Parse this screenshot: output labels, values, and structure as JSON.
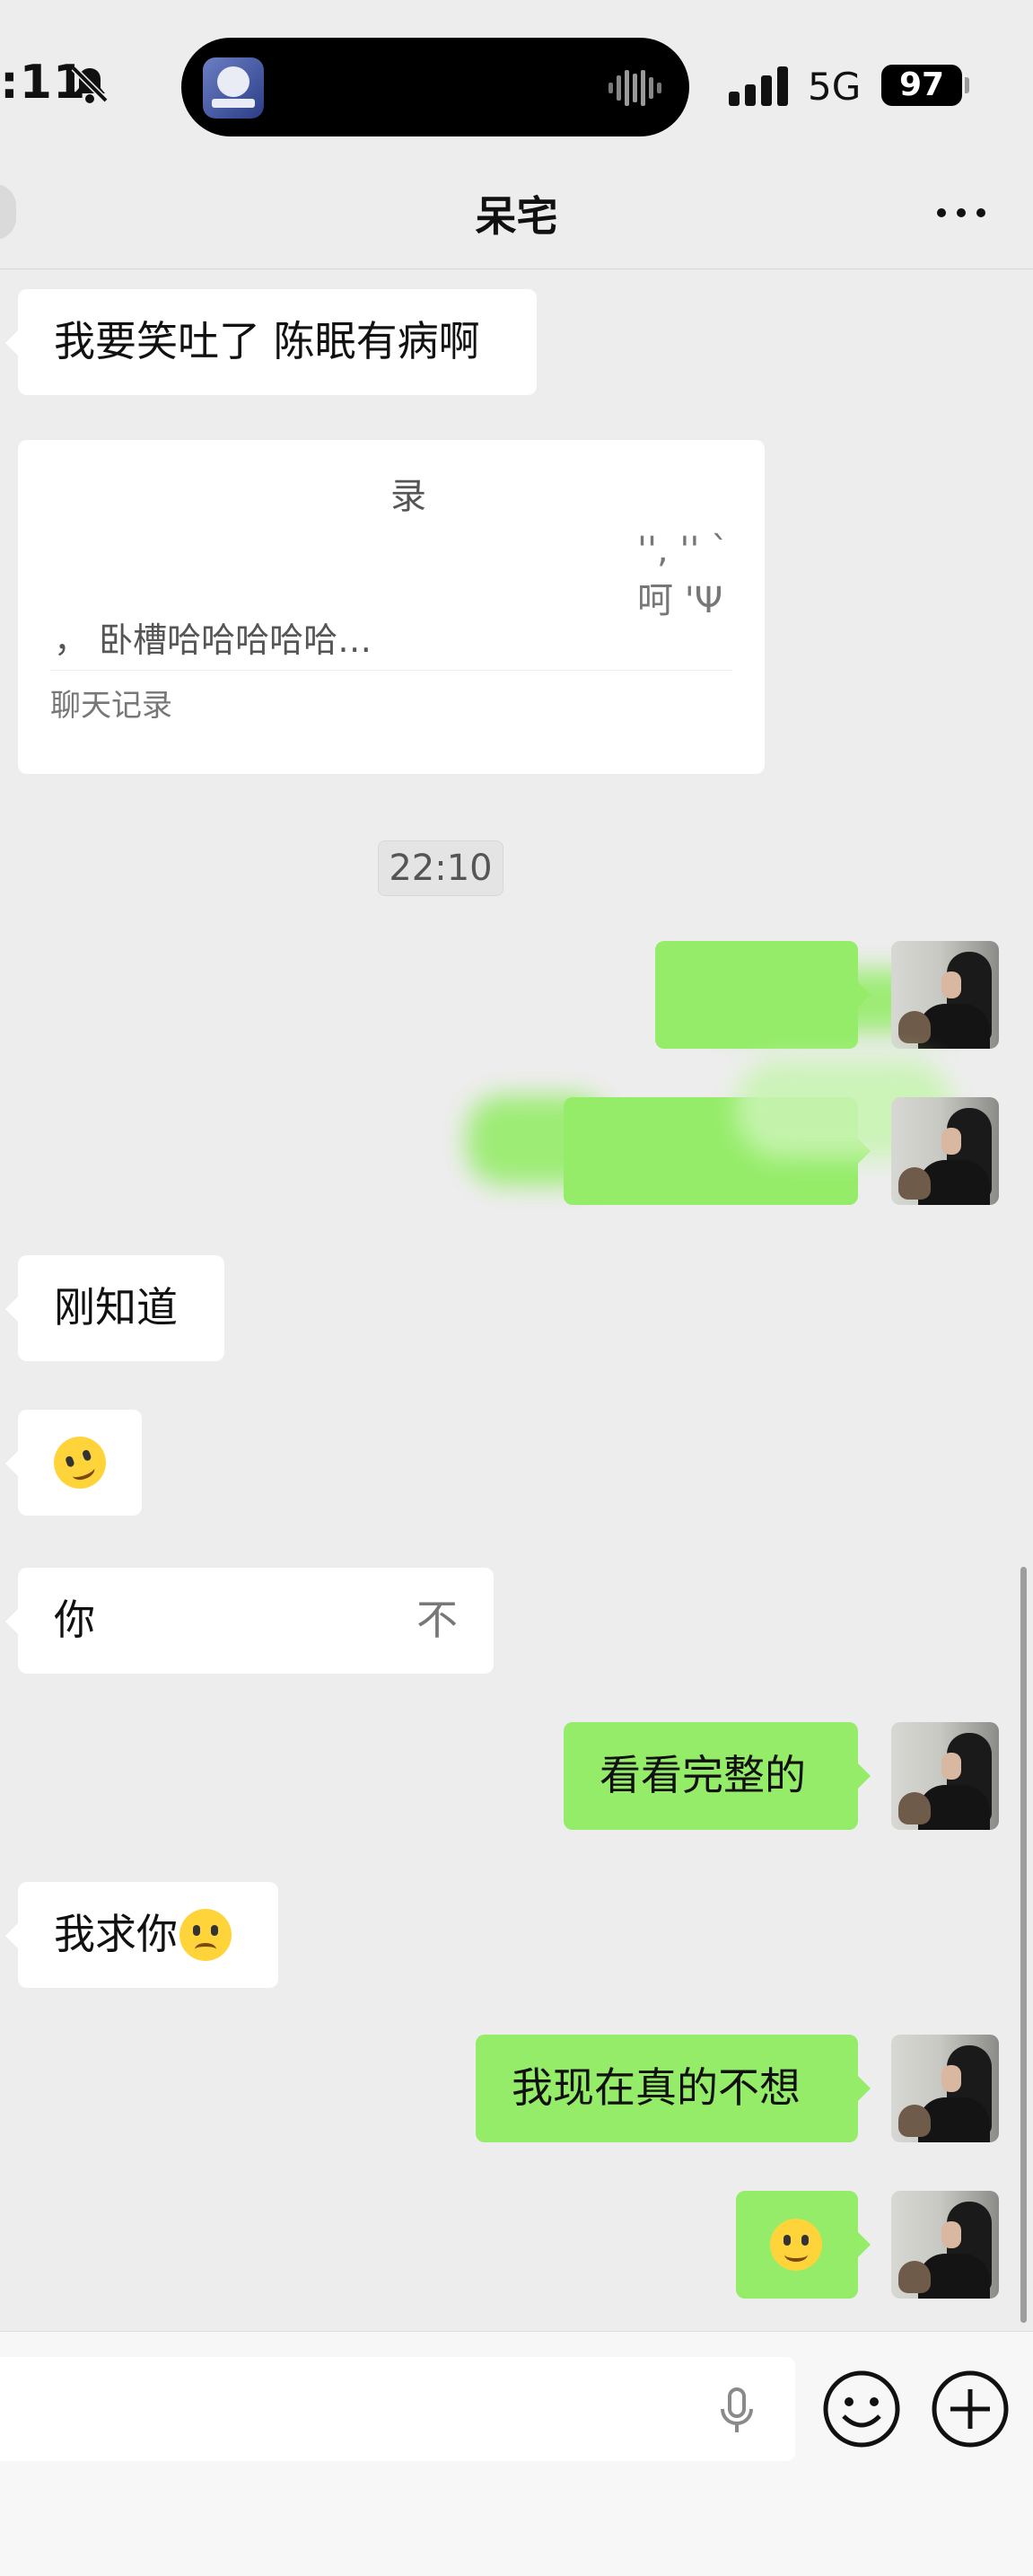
{
  "status_bar": {
    "time": ":11",
    "network": "5G",
    "battery": "97",
    "icons": [
      "bell-muted-icon",
      "island-app-icon",
      "audio-wave-icon",
      "signal-bars-icon"
    ]
  },
  "nav": {
    "title": "呆宅",
    "more_icon": "more-dots-icon",
    "back_icon": "back-button"
  },
  "messages": {
    "m1": "我要笑吐了 陈眠有病啊",
    "forward": {
      "title": "录",
      "line2": "'',  ''  `呵  'Ψ",
      "line3": "，        卧槽哈哈哈哈哈…",
      "label": "聊天记录"
    },
    "timestamp": "22:10",
    "m4": "刚知道",
    "m6_left": "你",
    "m6_right": "不",
    "m7": "看看完整的",
    "m8": "我求你",
    "m9": "我现在真的不想"
  },
  "input_bar": {
    "icons": [
      "mic-icon",
      "emoji-icon",
      "plus-icon"
    ]
  },
  "colors": {
    "background": "#ededed",
    "incoming_bubble": "#ffffff",
    "outgoing_bubble": "#95ec69",
    "input_bar": "#f7f7f7"
  }
}
